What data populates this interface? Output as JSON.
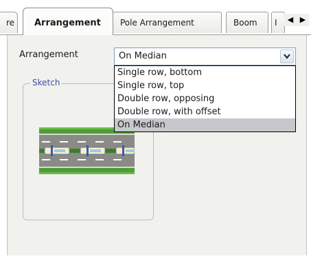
{
  "tabs": {
    "partial_left": "re",
    "active": "Arrangement",
    "pole": "Pole Arrangement",
    "boom": "Boom",
    "partial_right": "I"
  },
  "scroll_buttons": {
    "left": "◀",
    "right": "▶"
  },
  "arrangement": {
    "label": "Arrangement",
    "value": "On Median",
    "dropdown_icon": "chevron-down-icon",
    "options": [
      "Single row, bottom",
      "Single row, top",
      "Double row, opposing",
      "Double row, with offset",
      "On Median"
    ],
    "selected_index": 4
  },
  "sketch": {
    "title": "Sketch",
    "colors": {
      "grass": "#4f9c36",
      "road": "#8a8a86",
      "median": "#3c7d2b",
      "lane_mark": "#ffffff",
      "luminaire": "#f3efc8"
    }
  }
}
